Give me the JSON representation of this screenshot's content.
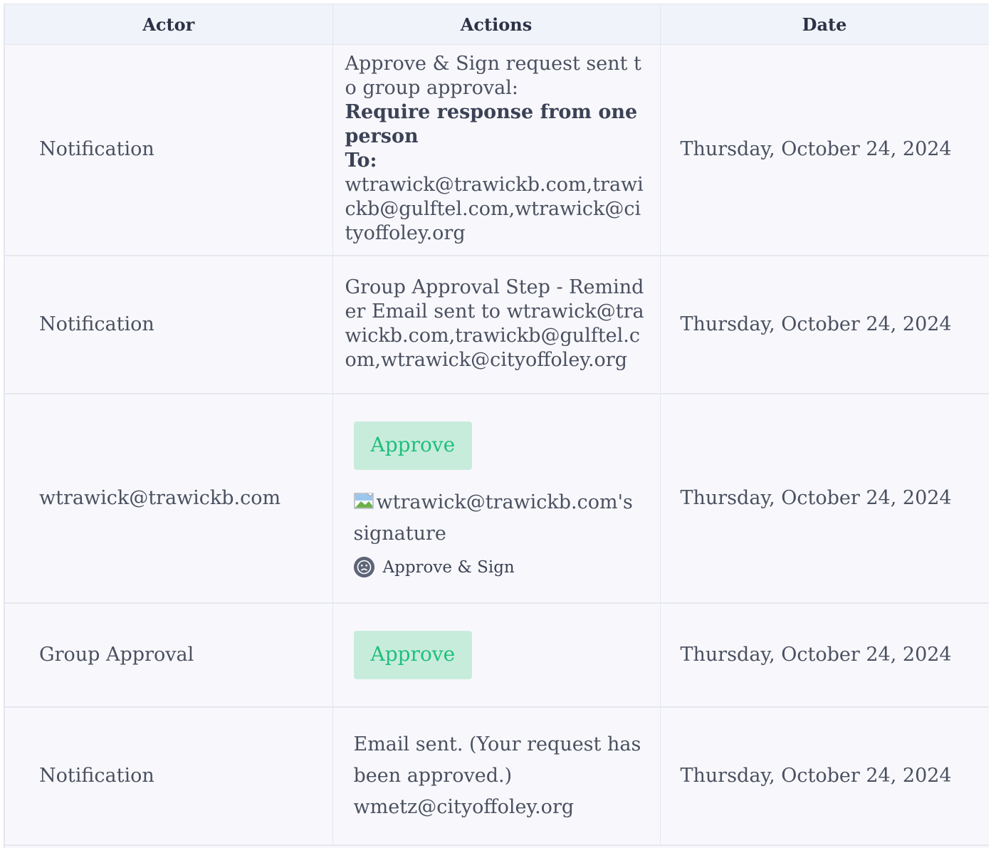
{
  "table": {
    "headers": {
      "actor": "Actor",
      "actions": "Actions",
      "date": "Date"
    },
    "rows": [
      {
        "actor": "Notification",
        "actions": {
          "line1": "Approve & Sign request sent to group approval:",
          "bold1": "Require response from one person",
          "bold2": "To:",
          "line2": "wtrawick@trawickb.com,trawickb@gulftel.com,wtrawick@cityoffoley.org"
        },
        "date": "Thursday, October 24, 2024"
      },
      {
        "actor": "Notification",
        "actions": {
          "line1": "Group Approval Step - Reminder Email sent to wtrawick@trawickb.com,trawickb@gulftel.com,wtrawick@cityoffoley.org"
        },
        "date": "Thursday, October 24, 2024"
      },
      {
        "actor": "wtrawick@trawickb.com",
        "actions": {
          "button": "Approve",
          "signature_alt": "wtrawick@trawickb.com's signature",
          "approve_sign": "Approve & Sign"
        },
        "date": "Thursday, October 24, 2024"
      },
      {
        "actor": "Group Approval",
        "actions": {
          "button": "Approve"
        },
        "date": "Thursday, October 24, 2024"
      },
      {
        "actor": "Notification",
        "actions": {
          "line1": "Email sent. (Your request has been approved.)",
          "line2": "wmetz@cityoffoley.org"
        },
        "date": "Thursday, October 24, 2024"
      }
    ]
  },
  "colors": {
    "approve_bg": "#c8ecdc",
    "approve_text": "#1fbf7c",
    "header_bg": "#f1f3fb",
    "row_bg": "#f8f8fc"
  },
  "icons": {
    "broken_image": "broken-image-icon",
    "avatar": "user-avatar-icon"
  }
}
